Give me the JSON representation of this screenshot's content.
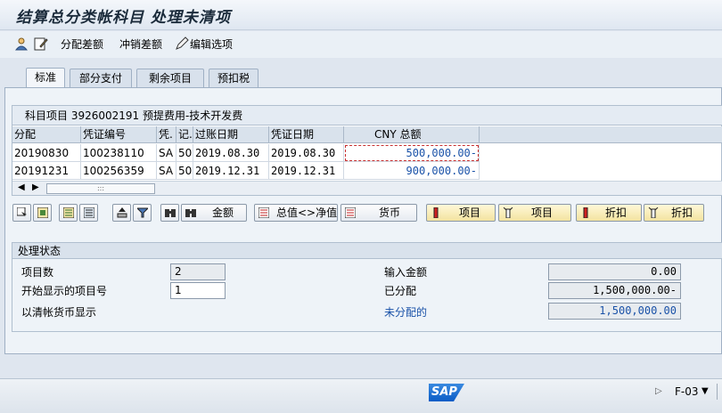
{
  "window": {
    "title": "结算总分类帐科目 处理未清项"
  },
  "toolbar": {
    "distribute_diff": "分配差额",
    "write_off_diff": "冲销差额",
    "edit_options": "编辑选项"
  },
  "tabs": [
    {
      "label": "标准",
      "active": true
    },
    {
      "label": "部分支付",
      "active": false
    },
    {
      "label": "剩余项目",
      "active": false
    },
    {
      "label": "预扣税",
      "active": false
    }
  ],
  "grid": {
    "title": "科目项目 3926002191 预提费用-技术开发费",
    "columns": [
      "分配",
      "凭证编号",
      "凭.",
      "记.",
      "过账日期",
      "凭证日期",
      "CNY 总额"
    ],
    "rows": [
      {
        "assign": "20190830",
        "doc_no": "100238110",
        "type": "SA",
        "posting_key": "50",
        "posting_date": "2019.08.30",
        "doc_date": "2019.08.30",
        "amount": "500,000.00-"
      },
      {
        "assign": "20191231",
        "doc_no": "100256359",
        "type": "SA",
        "posting_key": "50",
        "posting_date": "2019.12.31",
        "doc_date": "2019.12.31",
        "amount": "900,000.00-"
      }
    ],
    "scroll_marker": ":::"
  },
  "buttons": {
    "amount": "金额",
    "gross_net": "总值<>净值",
    "currency": "货币",
    "items1": "项目",
    "items2": "项目",
    "discount1": "折扣",
    "discount2": "折扣"
  },
  "status": {
    "title": "处理状态",
    "item_count_label": "项目数",
    "item_count": "2",
    "first_item_label": "开始显示的项目号",
    "first_item": "1",
    "clearing_currency_label": "以清帐货币显示",
    "entered_amount_label": "输入金额",
    "entered_amount": "0.00",
    "assigned_label": "已分配",
    "assigned": "1,500,000.00-",
    "unassigned_label": "未分配的",
    "unassigned": "1,500,000.00"
  },
  "footer": {
    "logo_text": "SAP",
    "transaction": "F-03"
  },
  "colors": {
    "link_blue": "#1a52a8",
    "sap_blue": "#0a5cc6"
  }
}
